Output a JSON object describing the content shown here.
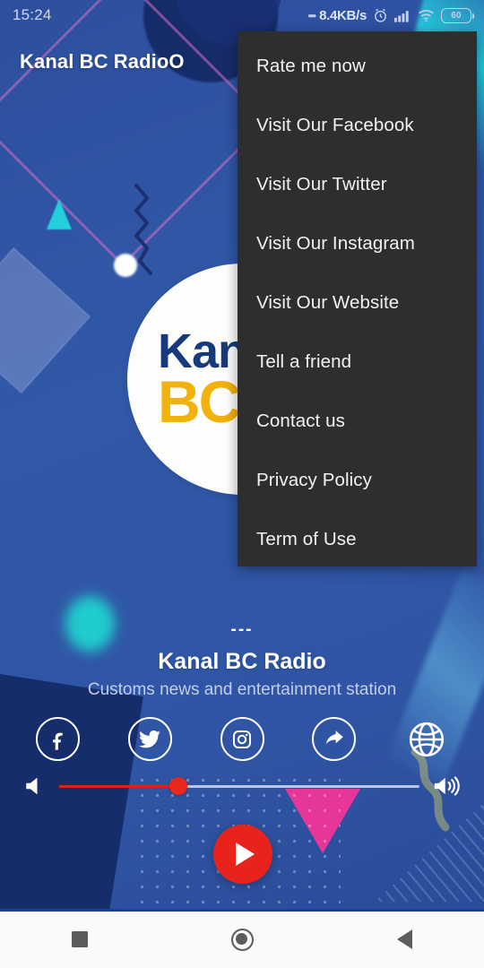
{
  "status_bar": {
    "time": "15:24",
    "leading_dots": "•••",
    "network_speed": "8.4KB/s",
    "alarm_icon": "alarm-clock-icon",
    "signal_icon": "cellular-signal-icon",
    "wifi_icon": "wifi-icon",
    "battery_level": "60"
  },
  "app": {
    "title": "Kanal BC RadioO",
    "logo": {
      "line1": "Kan",
      "line2": "BC"
    }
  },
  "now_playing": {
    "dashes": "---",
    "title": "Kanal BC Radio",
    "subtitle": "Customs news and entertainment station"
  },
  "social": [
    {
      "name": "facebook-icon",
      "label": "Facebook"
    },
    {
      "name": "twitter-icon",
      "label": "Twitter"
    },
    {
      "name": "instagram-icon",
      "label": "Instagram"
    },
    {
      "name": "share-icon",
      "label": "Share"
    },
    {
      "name": "website-globe-icon",
      "label": "Website"
    }
  ],
  "volume": {
    "mute_icon": "volume-mute-icon",
    "up_icon": "volume-up-icon",
    "percent": 33
  },
  "player": {
    "play_icon": "play-icon"
  },
  "menu": {
    "items": [
      {
        "label": "Rate me now"
      },
      {
        "label": "Visit Our Facebook"
      },
      {
        "label": "Visit Our Twitter"
      },
      {
        "label": "Visit Our Instagram"
      },
      {
        "label": "Visit Our Website"
      },
      {
        "label": "Tell a friend"
      },
      {
        "label": "Contact us"
      },
      {
        "label": "Privacy Policy"
      },
      {
        "label": "Term of Use"
      }
    ]
  },
  "navbar": {
    "recents": "recents-square-icon",
    "home": "home-circle-icon",
    "back": "back-triangle-icon"
  },
  "colors": {
    "background_blue": "#2f55a4",
    "menu_dark": "#2e2e2e",
    "accent_red": "#e8231c",
    "logo_navy": "#173a7c",
    "logo_gold": "#f2b20c",
    "pink": "#f0359a",
    "cyan": "#22d6e0"
  }
}
